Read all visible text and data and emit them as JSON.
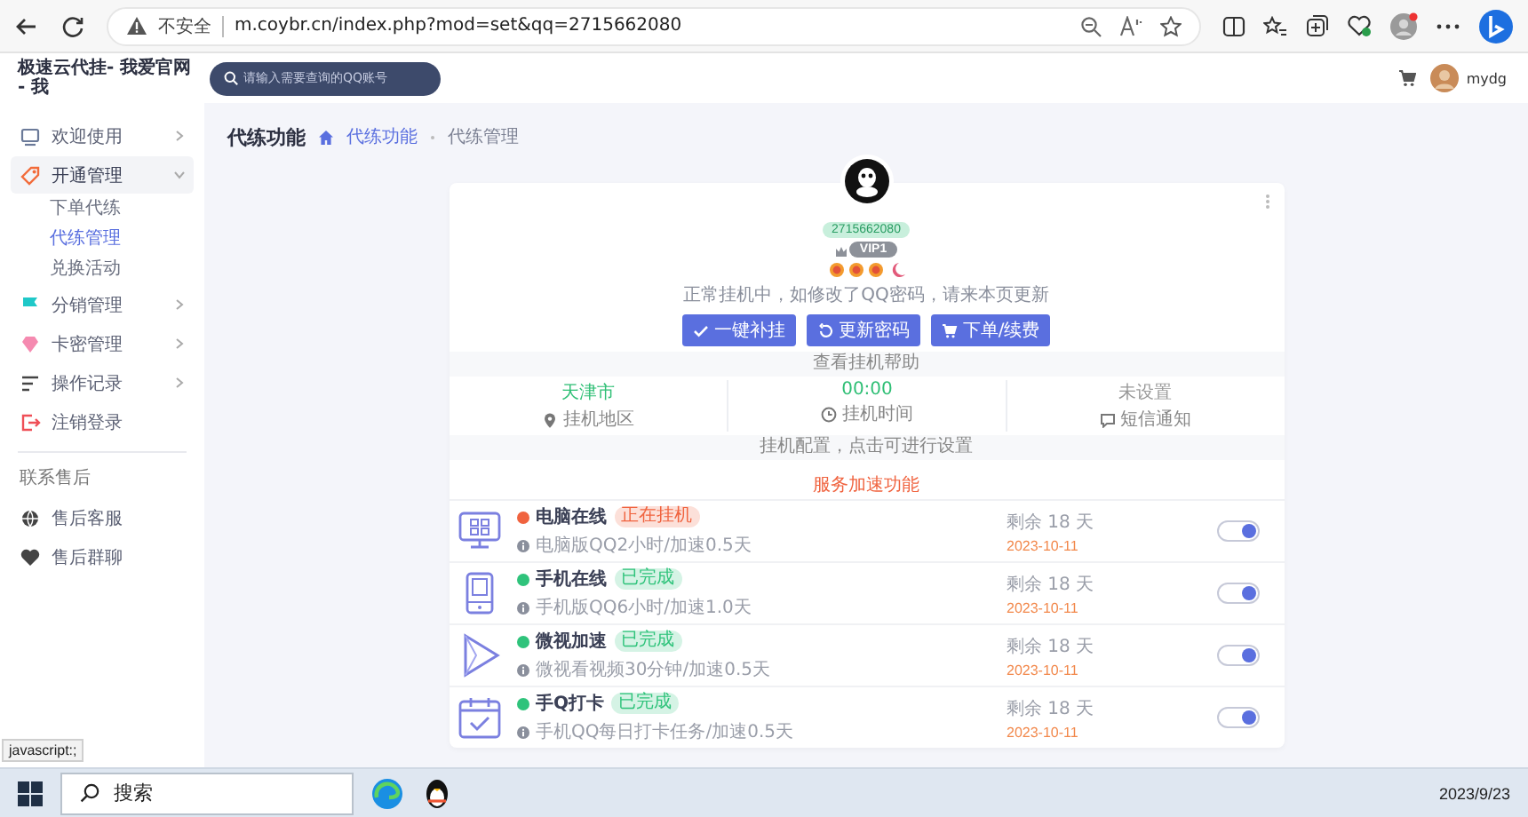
{
  "browser": {
    "security": "不安全",
    "url": "m.coybr.cn/index.php?mod=set&qq=2715662080"
  },
  "header": {
    "site_title": "极速云代挂- 我爱官网 - 我",
    "search_placeholder": "请输入需要查询的QQ账号",
    "user_name": "mydg"
  },
  "sidebar": {
    "items": [
      {
        "label": "欢迎使用",
        "selected": false,
        "expanded": false
      },
      {
        "label": "开通管理",
        "selected": true,
        "expanded": true,
        "children": [
          {
            "label": "下单代练",
            "selected": false
          },
          {
            "label": "代练管理",
            "selected": true
          },
          {
            "label": "兑换活动",
            "selected": false
          }
        ]
      },
      {
        "label": "分销管理",
        "selected": false,
        "expanded": false
      },
      {
        "label": "卡密管理",
        "selected": false,
        "expanded": false
      },
      {
        "label": "操作记录",
        "selected": false,
        "expanded": false
      },
      {
        "label": "注销登录",
        "selected": false
      }
    ],
    "section_title": "联系售后",
    "support_items": [
      {
        "label": "售后客服"
      },
      {
        "label": "售后群聊"
      }
    ]
  },
  "page_title": "代练功能",
  "breadcrumb": [
    "代练功能",
    "代练管理"
  ],
  "profile": {
    "qq": "2715662080",
    "vip": "VIP1",
    "status_text": "正常挂机中，如修改了QQ密码，请来本页更新",
    "buttons": [
      "一键补挂",
      "更新密码",
      "下单/续费"
    ]
  },
  "help_link": "查看挂机帮助",
  "stats": [
    {
      "value": "天津市",
      "label": "挂机地区",
      "set": true
    },
    {
      "value": "00:00",
      "label": "挂机时间",
      "set": true
    },
    {
      "value": "未设置",
      "label": "短信通知",
      "set": false
    }
  ],
  "config_text": "挂机配置，点击可进行设置",
  "services_title": "服务加速功能",
  "services": [
    {
      "name": "电脑在线",
      "status": "正在挂机",
      "color": "#f0633f",
      "desc": "电脑版QQ2小时/加速0.5天",
      "remaining": "剩余 18 天",
      "date": "2023-10-11",
      "on": true
    },
    {
      "name": "手机在线",
      "status": "已完成",
      "color": "#2fc37b",
      "desc": "手机版QQ6小时/加速1.0天",
      "remaining": "剩余 18 天",
      "date": "2023-10-11",
      "on": true
    },
    {
      "name": "微视加速",
      "status": "已完成",
      "color": "#2fc37b",
      "desc": "微视看视频30分钟/加速0.5天",
      "remaining": "剩余 18 天",
      "date": "2023-10-11",
      "on": true
    },
    {
      "name": "手Q打卡",
      "status": "已完成",
      "color": "#2fc37b",
      "desc": "手机QQ每日打卡任务/加速0.5天",
      "remaining": "剩余 18 天",
      "date": "2023-10-11",
      "on": true
    }
  ],
  "status_tooltip": "javascript:;",
  "taskbar": {
    "search_placeholder": "搜索",
    "date": "2023/9/23"
  }
}
